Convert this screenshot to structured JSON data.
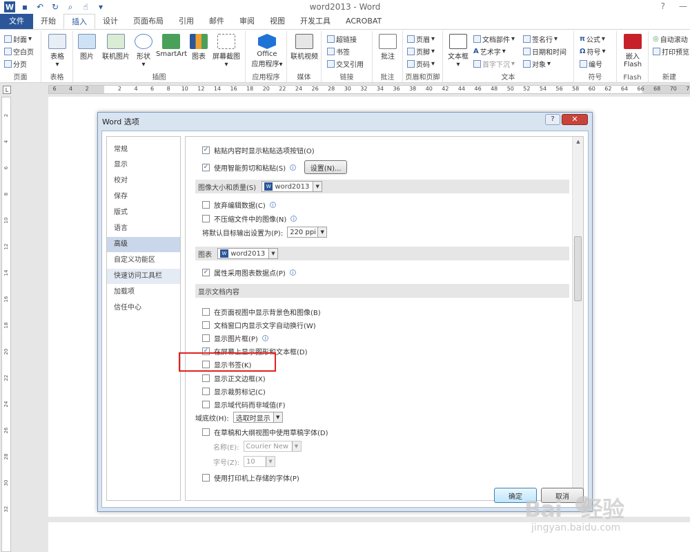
{
  "window": {
    "title": "word2013 - Word",
    "help": "?",
    "minimize": "—",
    "qat_icons": [
      "word-logo",
      "save-icon",
      "undo-icon",
      "redo-icon",
      "print-preview-icon",
      "touch-mode-icon",
      "customize-qat-icon"
    ],
    "logo_letter": "W"
  },
  "tabs": [
    {
      "label": "文件"
    },
    {
      "label": "开始"
    },
    {
      "label": "插入"
    },
    {
      "label": "设计"
    },
    {
      "label": "页面布局"
    },
    {
      "label": "引用"
    },
    {
      "label": "邮件"
    },
    {
      "label": "审阅"
    },
    {
      "label": "视图"
    },
    {
      "label": "开发工具"
    },
    {
      "label": "ACROBAT"
    }
  ],
  "ribbon": {
    "pages": {
      "label": "页面",
      "items": [
        "封面",
        "空白页",
        "分页"
      ]
    },
    "tables": {
      "label": "表格",
      "items": [
        "表格"
      ]
    },
    "illustrations": {
      "label": "插图",
      "items": [
        "图片",
        "联机图片",
        "形状",
        "SmartArt",
        "图表",
        "屏幕截图"
      ]
    },
    "apps": {
      "label": "应用程序",
      "items": [
        "Office",
        "应用程序"
      ]
    },
    "media": {
      "label": "媒体",
      "items": [
        "联机视频"
      ]
    },
    "links": {
      "label": "链接",
      "items": [
        "超链接",
        "书签",
        "交叉引用"
      ]
    },
    "comments": {
      "label": "批注",
      "items": [
        "批注"
      ]
    },
    "header_footer": {
      "label": "页眉和页脚",
      "items": [
        "页眉",
        "页脚",
        "页码"
      ]
    },
    "text": {
      "label": "文本",
      "items": [
        "文本框",
        "文档部件",
        "艺术字",
        "首字下沉",
        "签名行",
        "日期和时间",
        "对象"
      ]
    },
    "symbols": {
      "label": "符号",
      "items": [
        "公式",
        "符号",
        "编号"
      ]
    },
    "flash": {
      "label": "Flash",
      "items": [
        "嵌入",
        "Flash"
      ]
    },
    "new_group": {
      "label": "新建",
      "items": [
        "自动滚动",
        "打印预览"
      ]
    }
  },
  "ruler": {
    "numbers": [
      "6",
      "4",
      "2",
      "",
      "2",
      "4",
      "6",
      "8",
      "10",
      "12",
      "14",
      "16",
      "18",
      "20",
      "22",
      "24",
      "26",
      "28",
      "30",
      "32",
      "34",
      "36",
      "38",
      "40",
      "42",
      "44",
      "46",
      "48",
      "50",
      "52",
      "54",
      "56",
      "58",
      "60",
      "62",
      "64",
      "66",
      "68",
      "70",
      "72"
    ],
    "vnumbers": [
      "2",
      "4",
      "6",
      "8",
      "10",
      "12",
      "14",
      "16",
      "18",
      "20",
      "22",
      "24",
      "26",
      "28",
      "30",
      "32"
    ]
  },
  "dialog": {
    "title": "Word 选项",
    "help": "?",
    "close": "✕",
    "nav": [
      "常规",
      "显示",
      "校对",
      "保存",
      "版式",
      "语言",
      "高级",
      "自定义功能区",
      "快速访问工具栏",
      "加载项",
      "信任中心"
    ],
    "selected_nav": "高级",
    "options": {
      "paste_buttons": "粘贴内容时显示粘贴选项按钮(O)",
      "smart_cut": "使用智能剪切和粘贴(S)",
      "settings_btn": "设置(N)...",
      "image_section": "图像大小和质量(S)",
      "image_doc": "word2013",
      "discard_edit": "放弃编辑数据(C)",
      "no_compress": "不压缩文件中的图像(N)",
      "default_output": "将默认目标输出设置为(P):",
      "ppi_value": "220 ppi",
      "chart_section": "图表",
      "chart_doc": "word2013",
      "chart_props": "属性采用图表数据点(P)",
      "display_section": "显示文档内容",
      "bg_colors": "在页面视图中显示背景色和图像(B)",
      "wrap_text": "文档窗口内显示文字自动换行(W)",
      "pic_placeholders": "显示图片框(P)",
      "drawings": "在屏幕上显示图形和文本框(D)",
      "bookmarks": "显示书签(K)",
      "text_bounds": "显示正文边框(X)",
      "crop_marks": "显示裁剪标记(C)",
      "field_codes": "显示域代码而非域值(F)",
      "field_shading": "域底纹(H):",
      "field_shading_value": "选取时显示",
      "draft_font": "在草稿和大纲视图中使用草稿字体(D)",
      "font_name": "名称(E):",
      "font_name_value": "Courier New",
      "font_size": "字号(Z):",
      "font_size_value": "10",
      "printer_fonts": "使用打印机上存储的字体(P)"
    },
    "ok": "确定",
    "cancel": "取消"
  },
  "watermark": {
    "brand": "Bai",
    "brand2": "经验",
    "url": "jingyan.baidu.com"
  },
  "accent": "#2b579a",
  "highlight_color": "#e02020"
}
